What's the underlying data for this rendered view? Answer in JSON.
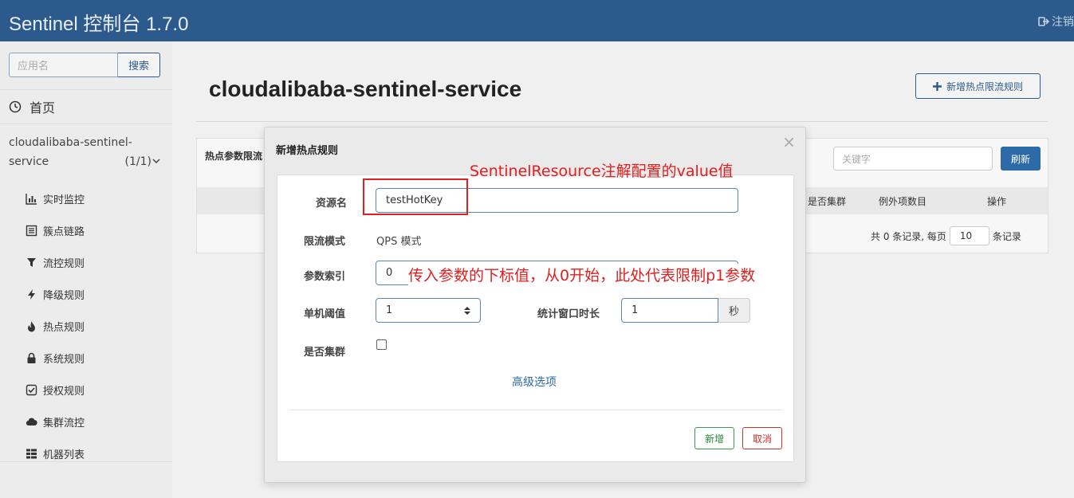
{
  "header": {
    "brand": "Sentinel 控制台 1.7.0",
    "logout_label": "注销"
  },
  "sidebar": {
    "search_placeholder": "应用名",
    "search_button": "搜索",
    "home_label": "首页",
    "app_name": "cloudalibaba-sentinel-service",
    "app_count": "(1/1)",
    "menu": [
      {
        "label": "实时监控",
        "icon": "bar-chart-icon"
      },
      {
        "label": "簇点链路",
        "icon": "list-icon"
      },
      {
        "label": "流控规则",
        "icon": "filter-icon"
      },
      {
        "label": "降级规则",
        "icon": "flash-icon"
      },
      {
        "label": "热点规则",
        "icon": "fire-icon"
      },
      {
        "label": "系统规则",
        "icon": "lock-icon"
      },
      {
        "label": "授权规则",
        "icon": "check-icon"
      },
      {
        "label": "集群流控",
        "icon": "cloud-icon"
      },
      {
        "label": "机器列表",
        "icon": "grid-icon"
      }
    ]
  },
  "main": {
    "title": "cloudalibaba-sentinel-service",
    "add_rule_button": "新增热点限流规则",
    "panel_title": "热点参数限流",
    "keyword_placeholder": "关键字",
    "refresh_button": "刷新",
    "columns": [
      "是否集群",
      "例外项数目",
      "操作"
    ],
    "pager": {
      "prefix": "共 0 条记录, 每页",
      "page_size": "10",
      "suffix": "条记录"
    }
  },
  "modal": {
    "title": "新增热点规则",
    "close": "×",
    "resource_label": "资源名",
    "resource_value": "testHotKey",
    "mode_label": "限流模式",
    "mode_value": "QPS 模式",
    "param_label": "参数索引",
    "param_value": "0",
    "threshold_label": "单机阈值",
    "threshold_value": "1",
    "window_label": "统计窗口时长",
    "window_value": "1",
    "window_unit": "秒",
    "cluster_label": "是否集群",
    "cluster_checked": false,
    "advanced_link": "高级选项",
    "add_button": "新增",
    "cancel_button": "取消"
  },
  "annotations": {
    "resource_note": "SentinelResource注解配置的value值",
    "param_note": "传入参数的下标值，从0开始，此处代表限制p1参数",
    "color": "#e02020"
  }
}
